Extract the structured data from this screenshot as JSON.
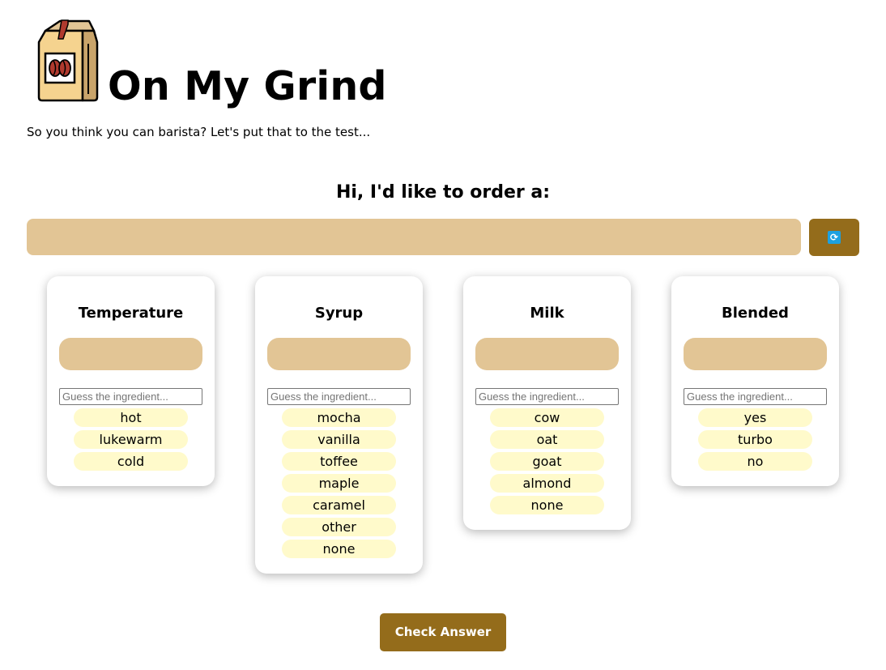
{
  "app": {
    "title": "On My Grind",
    "subtitle": "So you think you can barista? Let's put that to the test...",
    "logo_icon": "coffee-bag-icon"
  },
  "order": {
    "heading": "Hi, I'd like to order a:",
    "value": "",
    "refresh_icon": "refresh-icon"
  },
  "categories": [
    {
      "title": "Temperature",
      "placeholder": "Guess the ingredient...",
      "options": [
        "hot",
        "lukewarm",
        "cold"
      ]
    },
    {
      "title": "Syrup",
      "placeholder": "Guess the ingredient...",
      "options": [
        "mocha",
        "vanilla",
        "toffee",
        "maple",
        "caramel",
        "other",
        "none"
      ]
    },
    {
      "title": "Milk",
      "placeholder": "Guess the ingredient...",
      "options": [
        "cow",
        "oat",
        "goat",
        "almond",
        "none"
      ]
    },
    {
      "title": "Blended",
      "placeholder": "Guess the ingredient...",
      "options": [
        "yes",
        "turbo",
        "no"
      ]
    }
  ],
  "actions": {
    "check_label": "Check Answer"
  },
  "colors": {
    "accent": "#946c1b",
    "slot": "#e2c595",
    "option": "#fffacb",
    "refresh_icon": "#1da1e0"
  }
}
